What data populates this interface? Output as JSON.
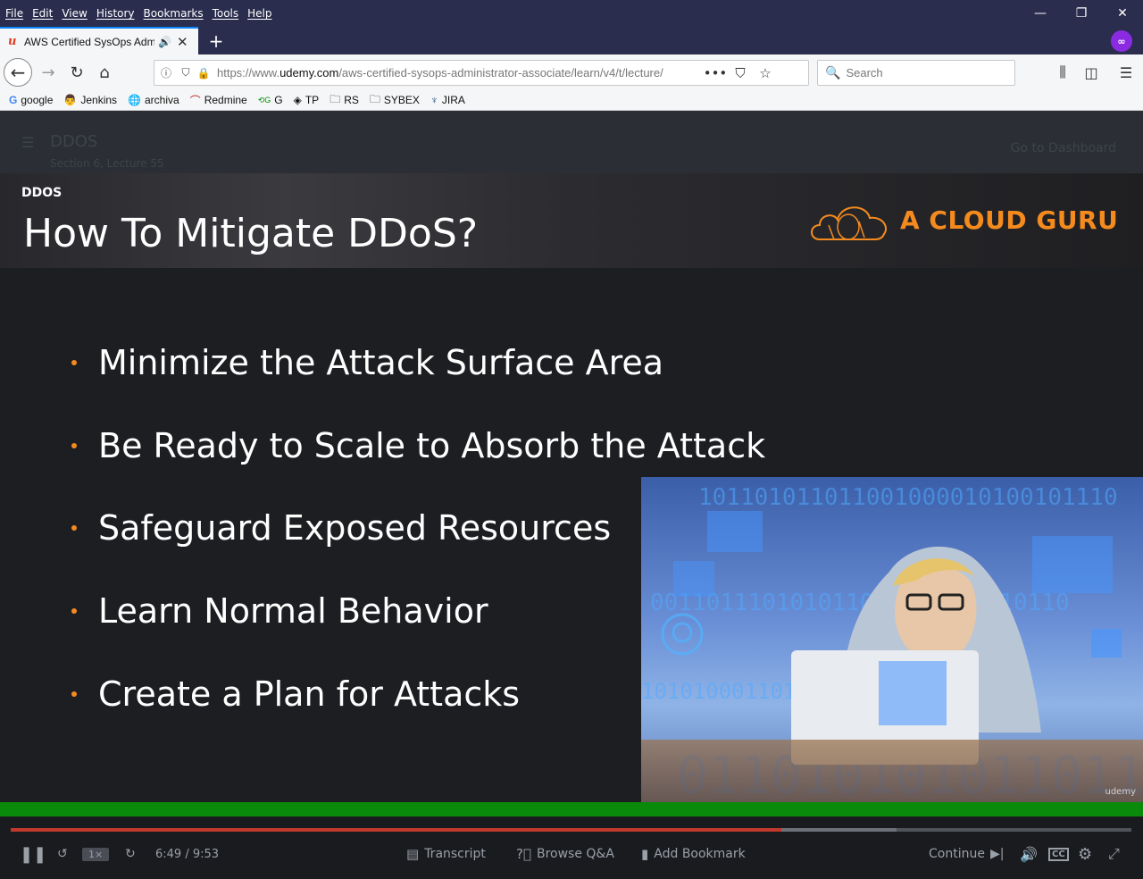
{
  "menu": [
    "File",
    "Edit",
    "View",
    "History",
    "Bookmarks",
    "Tools",
    "Help"
  ],
  "window_controls": {
    "minimize": "—",
    "restore": "❐",
    "close": "✕"
  },
  "tab": {
    "title": "AWS Certified SysOps Admi",
    "favicon": "u"
  },
  "navbar": {
    "url_prefix": "https://www.",
    "url_domain": "udemy.com",
    "url_path": "/aws-certified-sysops-administrator-associate/learn/v4/t/lecture/",
    "search_placeholder": "Search"
  },
  "bookmarks": [
    {
      "label": "google",
      "icon": "google-icon"
    },
    {
      "label": "Jenkins",
      "icon": "jenkins-icon"
    },
    {
      "label": "archiva",
      "icon": "globe-icon"
    },
    {
      "label": "Redmine",
      "icon": "redmine-icon"
    },
    {
      "label": "G",
      "icon": "deepl-icon"
    },
    {
      "label": "TP",
      "icon": "diamond-icon"
    },
    {
      "label": "RS",
      "icon": "folder-icon"
    },
    {
      "label": "SYBEX",
      "icon": "folder-icon"
    },
    {
      "label": "JIRA",
      "icon": "jira-icon"
    }
  ],
  "lecture": {
    "title": "DDOS",
    "subtitle": "Section 6, Lecture 55",
    "dashboard_link": "Go to Dashboard"
  },
  "slide": {
    "tag": "DDOS",
    "heading": "How To Mitigate DDoS?",
    "brand": "A CLOUD GURU",
    "bullets": [
      "Minimize the Attack Surface Area",
      "Be Ready to Scale to Absorb the Attack",
      "Safeguard Exposed Resources",
      "Learn Normal Behavior",
      "Create a Plan for Attacks"
    ],
    "binary_rows": [
      "101101011011001000010100101110",
      "001101110101011000101011110110",
      "10101000110111010110",
      "0110101010110110"
    ]
  },
  "player": {
    "time": "6:49 / 9:53",
    "playback_rate": "1×",
    "played_fraction": 0.6877,
    "buffered_fraction": 0.7902,
    "transcript": "Transcript",
    "browse_qa": "Browse Q&A",
    "add_bookmark": "Add Bookmark",
    "continue": "Continue",
    "watermark": "udemy"
  }
}
